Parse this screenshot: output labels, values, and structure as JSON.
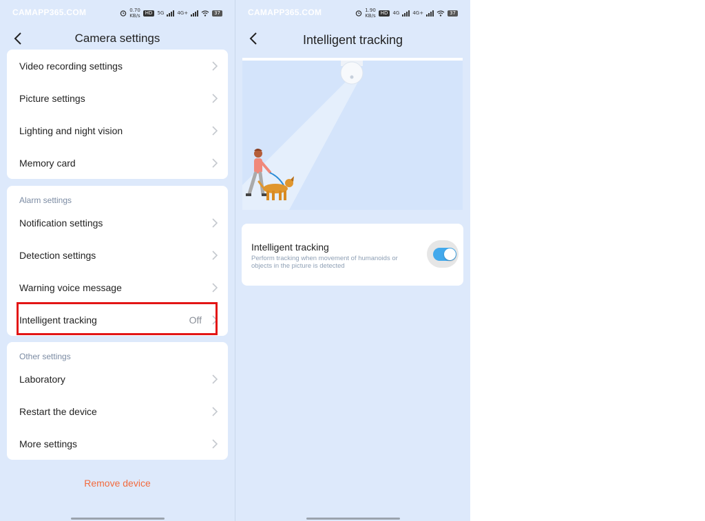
{
  "status": {
    "watermark": "CAMAPP365.COM",
    "left_speed": "0.70",
    "right_speed": "1.90",
    "speed_unit": "KB/s",
    "hd": "HD",
    "left_network": "5G",
    "right_network": "4G",
    "network_2": "4G+",
    "battery": "37"
  },
  "left": {
    "title": "Camera settings",
    "group1": [
      {
        "label": "Video recording settings"
      },
      {
        "label": "Picture settings"
      },
      {
        "label": "Lighting and night vision"
      },
      {
        "label": "Memory card"
      }
    ],
    "group2": {
      "header": "Alarm settings",
      "items": [
        {
          "label": "Notification settings"
        },
        {
          "label": "Detection settings"
        },
        {
          "label": "Warning voice message"
        },
        {
          "label": "Intelligent tracking",
          "value": "Off"
        }
      ]
    },
    "group3": {
      "header": "Other settings",
      "items": [
        {
          "label": "Laboratory"
        },
        {
          "label": "Restart the device"
        },
        {
          "label": "More settings"
        }
      ]
    },
    "remove_label": "Remove device"
  },
  "right": {
    "title": "Intelligent tracking",
    "toggle_title": "Intelligent tracking",
    "toggle_desc": "Perform tracking when movement of humanoids or objects in the picture is detected",
    "toggle_on": true
  },
  "icons": {
    "back": "chevron-left-icon",
    "row": "chevron-right-icon",
    "alarm": "alarm-icon",
    "wifi": "wifi-icon",
    "battery": "battery-icon",
    "signal": "signal-icon"
  },
  "colors": {
    "background": "#dde9fb",
    "card": "#ffffff",
    "accent_toggle": "#43a9ec",
    "remove": "#f26a3d",
    "highlight": "#e31515",
    "section_header": "#7b8ba3"
  }
}
